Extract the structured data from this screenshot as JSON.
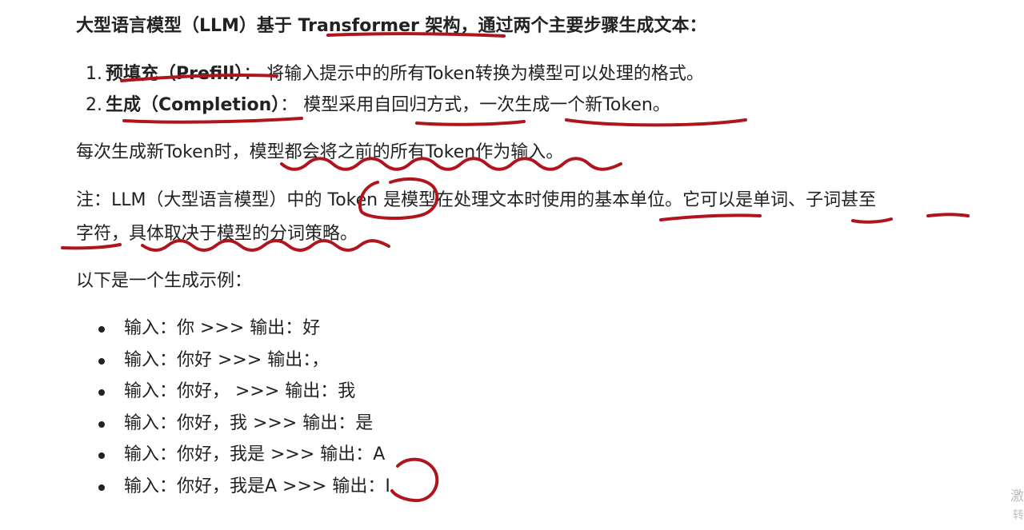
{
  "intro": {
    "part1": "大型语言模型（LLM）基于 ",
    "part2": "Transformer 架构",
    "part3": "，通过两个主要步骤生成文本："
  },
  "steps": [
    {
      "number": "1.",
      "term": "预填充（Prefill）",
      "desc": "：  将输入提示中的所有Token转换为模型可以处理的格式。"
    },
    {
      "number": "2.",
      "term": "生成（Completion）",
      "desc": "：  模型采用自回归方式，一次生成一个新Token。"
    }
  ],
  "each_time": "每次生成新Token时，模型都会将之前的所有Token作为输入。",
  "note": {
    "line1": "注：LLM（大型语言模型）中的 Token 是模型在处理文本时使用的基本单位。它可以是单词、子词甚至",
    "line2": "字符，具体取决于模型的分词策略。"
  },
  "example_heading": "以下是一个生成示例：",
  "examples": [
    "输入：你 >>> 输出：好",
    "输入：你好 >>> 输出：，",
    "输入：你好，  >>> 输出：我",
    "输入：你好，我 >>> 输出：是",
    "输入：你好，我是 >>> 输出：A",
    "输入：你好，我是A >>> 输出：I"
  ],
  "side_text": [
    "激",
    "转"
  ],
  "annotation_color": "#b0141c"
}
